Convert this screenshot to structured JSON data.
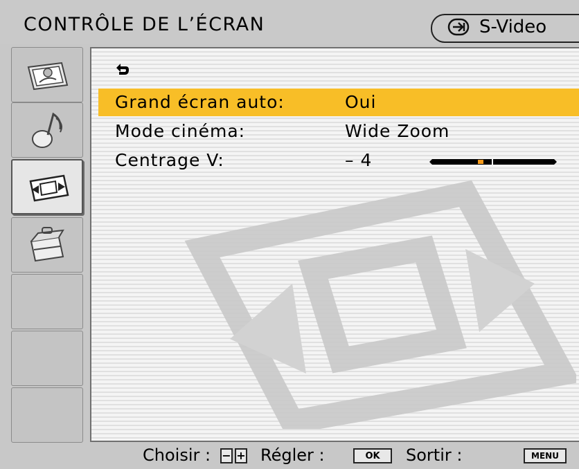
{
  "header": {
    "title": "CONTRÔLE DE L’ÉCRAN",
    "input_source": "S-Video",
    "input_icon": "input-arrow-icon"
  },
  "sidebar": {
    "tabs": [
      {
        "icon": "picture-icon",
        "active": false
      },
      {
        "icon": "sound-icon",
        "active": false
      },
      {
        "icon": "screen-control-icon",
        "active": true
      },
      {
        "icon": "setup-toolbox-icon",
        "active": false
      },
      {
        "icon": "",
        "active": false
      },
      {
        "icon": "",
        "active": false
      },
      {
        "icon": "",
        "active": false
      }
    ]
  },
  "menu": {
    "back_icon": "back-arrow-icon",
    "rows": [
      {
        "label": "Grand écran auto:",
        "value": "Oui",
        "selected": true
      },
      {
        "label": "Mode cinéma:",
        "value": "Wide Zoom",
        "selected": false
      },
      {
        "label": "Centrage V:",
        "value": "– 4",
        "selected": false,
        "slider_level": 0.4
      }
    ]
  },
  "footer": {
    "choose_label": "Choisir :",
    "minus_key": "−",
    "plus_key": "+",
    "adjust_label": "Régler :",
    "ok_key": "OK",
    "exit_label": "Sortir :",
    "menu_key": "MENU"
  },
  "colors": {
    "highlight": "#f8be27",
    "slider_marker": "#f59a1c",
    "background": "#c8c8c8"
  }
}
